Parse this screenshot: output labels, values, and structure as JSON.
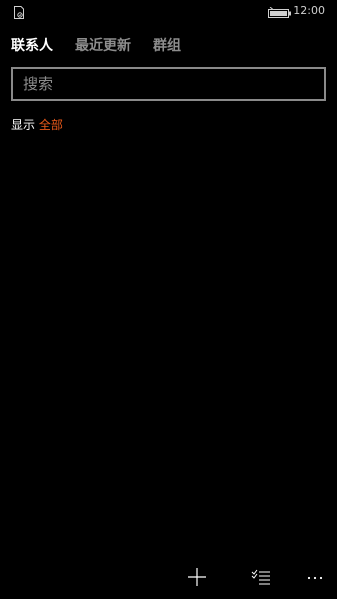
{
  "status_bar": {
    "time": "12:00",
    "sim_icon": "sim-card-icon",
    "battery_icon": "battery-charging-icon"
  },
  "pivot": {
    "tabs": [
      {
        "label": "联系人",
        "active": true
      },
      {
        "label": "最近更新",
        "active": false
      },
      {
        "label": "群组",
        "active": false
      }
    ]
  },
  "search": {
    "placeholder": "搜索",
    "value": ""
  },
  "filter": {
    "label": "显示",
    "value": "全部"
  },
  "app_bar": {
    "buttons": [
      {
        "icon": "add-icon"
      },
      {
        "icon": "select-list-icon"
      },
      {
        "icon": "more-icon"
      }
    ]
  },
  "colors": {
    "background": "#000000",
    "accent": "#e8591a",
    "inactive_text": "#8d8d8d",
    "border": "#8a8a8a"
  }
}
